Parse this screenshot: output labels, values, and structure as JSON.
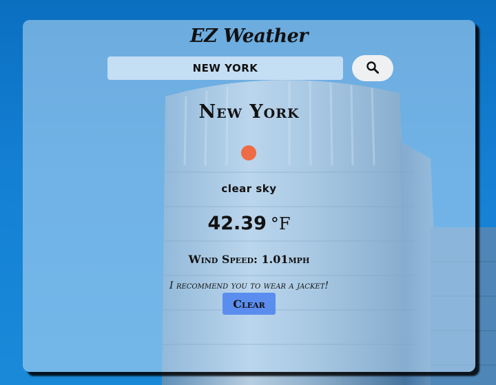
{
  "app": {
    "title": "EZ Weather"
  },
  "search": {
    "value": "NEW YORK",
    "icon": "search-icon"
  },
  "weather": {
    "city": "New York",
    "icon": "weather-icon",
    "description": "clear sky",
    "temperature": "42.39",
    "unit": "°F",
    "wind": "Wind Speed: 1.01mph",
    "recommendation": "I recommend you to wear a jacket!"
  },
  "actions": {
    "clear_label": "Clear"
  },
  "colors": {
    "accent_button": "#5b8def",
    "weather_dot": "#ee6b45",
    "page_background": "#0a73c4"
  }
}
